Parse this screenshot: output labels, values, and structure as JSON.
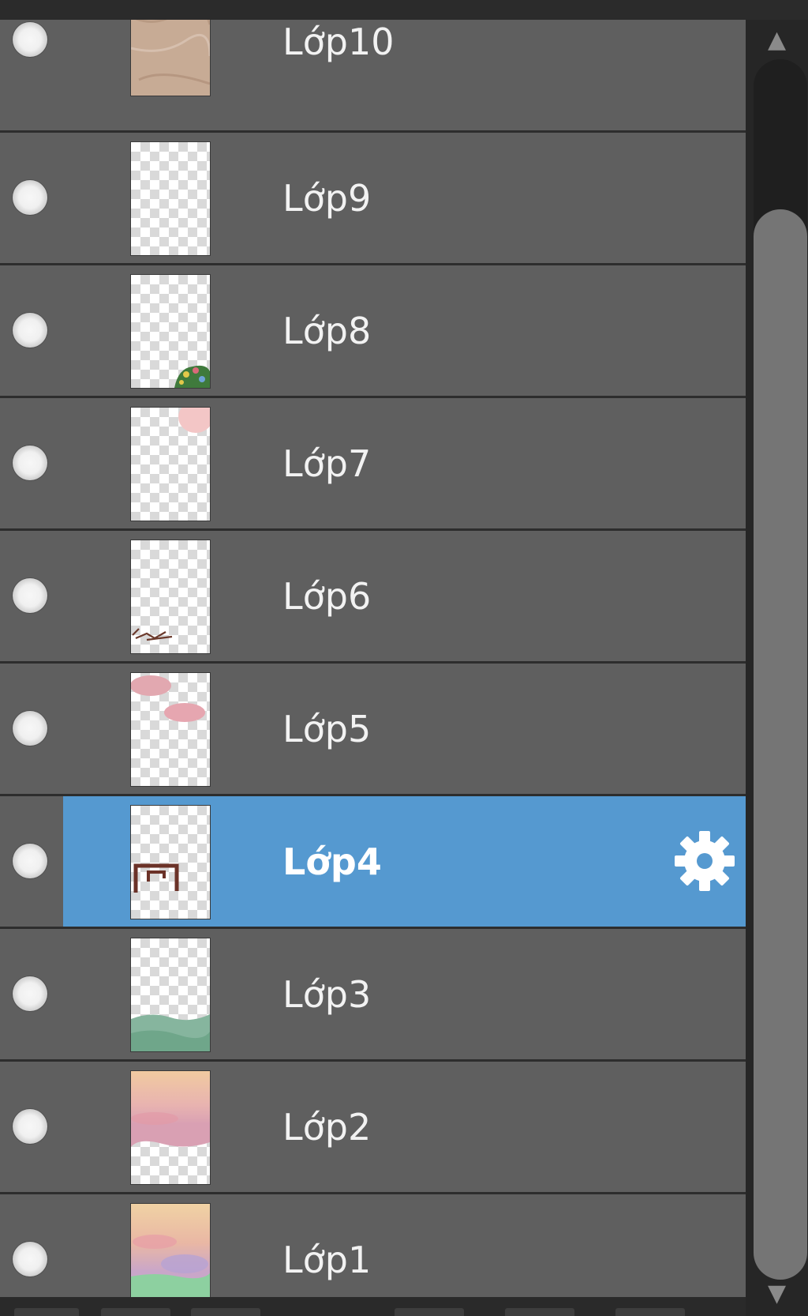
{
  "layers_panel": {
    "layers": [
      {
        "name": "Lớp10",
        "visible": true,
        "selected": false,
        "thumbnail": "paper-texture"
      },
      {
        "name": "Lớp9",
        "visible": true,
        "selected": false,
        "thumbnail": "empty"
      },
      {
        "name": "Lớp8",
        "visible": true,
        "selected": false,
        "thumbnail": "flowers-bottom-right"
      },
      {
        "name": "Lớp7",
        "visible": true,
        "selected": false,
        "thumbnail": "pink-top-right"
      },
      {
        "name": "Lớp6",
        "visible": true,
        "selected": false,
        "thumbnail": "sketch-bottom-left"
      },
      {
        "name": "Lớp5",
        "visible": true,
        "selected": false,
        "thumbnail": "pink-clouds"
      },
      {
        "name": "Lớp4",
        "visible": true,
        "selected": true,
        "thumbnail": "brown-frame"
      },
      {
        "name": "Lớp3",
        "visible": true,
        "selected": false,
        "thumbnail": "green-bottom"
      },
      {
        "name": "Lớp2",
        "visible": true,
        "selected": false,
        "thumbnail": "sunset-top"
      },
      {
        "name": "Lớp1",
        "visible": true,
        "selected": false,
        "thumbnail": "sunset-full"
      }
    ],
    "selected_icon": "gear-icon",
    "visibility_icon": "eye-dot-icon"
  },
  "scrollbar": {
    "up_icon": "▲",
    "down_icon": "▼"
  },
  "colors": {
    "row_bg": "#5f5f5f",
    "selected_bg": "#5599d0",
    "text": "#f2f2f2"
  }
}
